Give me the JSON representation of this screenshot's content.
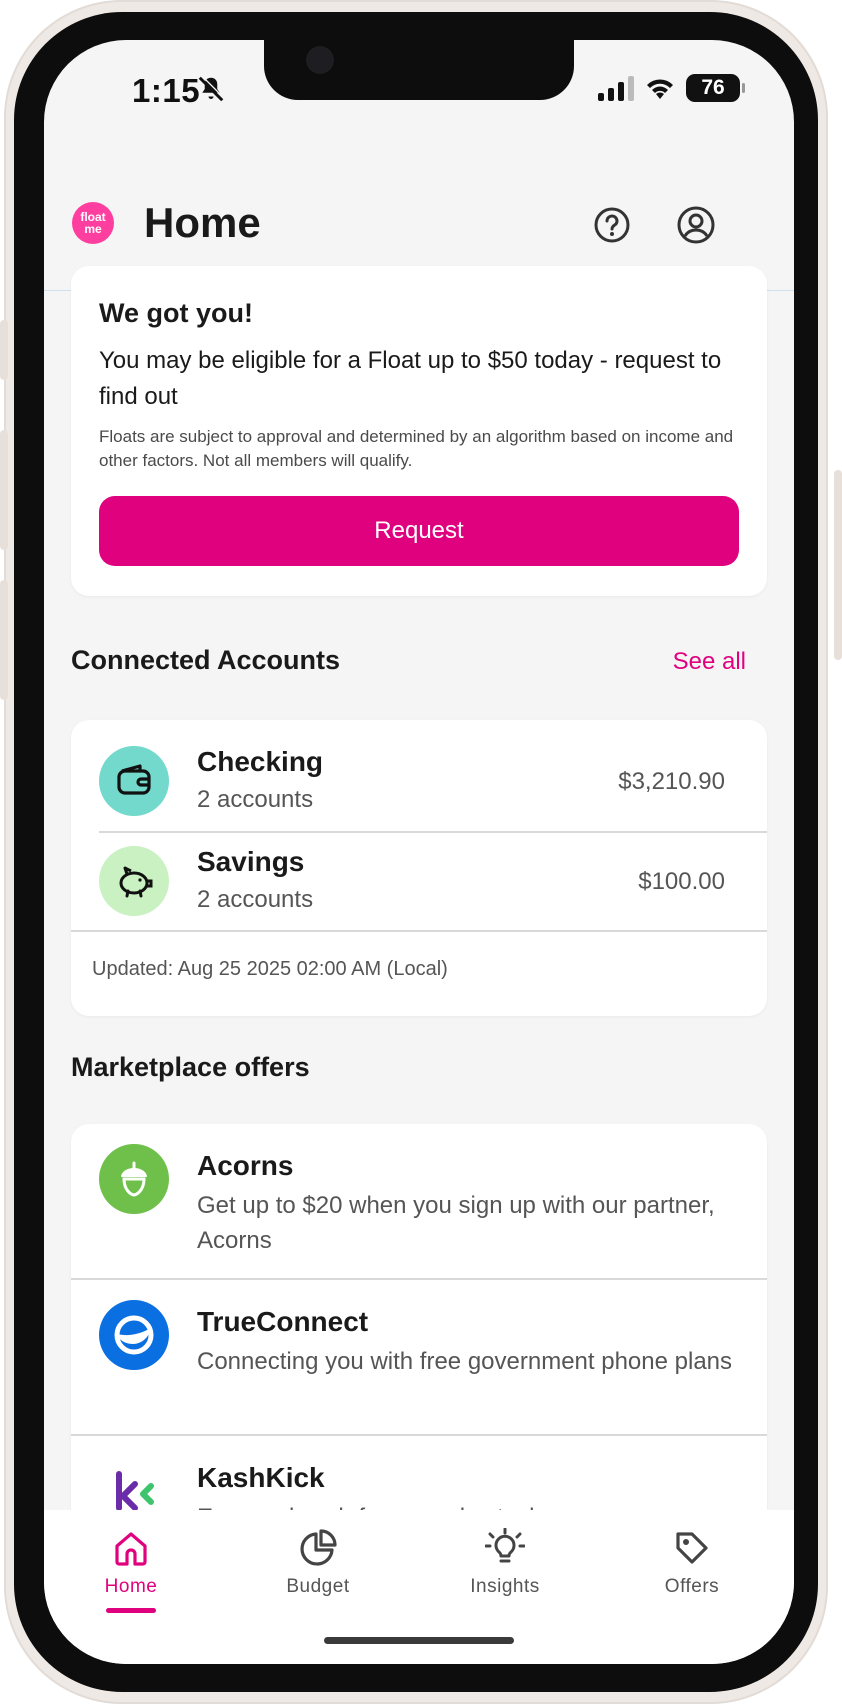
{
  "status": {
    "time": "1:15",
    "battery": "76"
  },
  "header": {
    "title": "Home",
    "logo_text": "float me"
  },
  "promo": {
    "title": "We got you!",
    "body": "You may be eligible for a Float up to $50 today - request to find out",
    "fine_print": "Floats are subject to approval and determined by an algorithm based on income and other factors. Not all members will qualify.",
    "button_label": "Request"
  },
  "accounts": {
    "section_title": "Connected Accounts",
    "see_all_label": "See all",
    "items": [
      {
        "name": "Checking",
        "sub": "2 accounts",
        "amount": "$3,210.90",
        "color": "#72d9cc"
      },
      {
        "name": "Savings",
        "sub": "2 accounts",
        "amount": "$100.00",
        "color": "#c9f1c1"
      }
    ],
    "updated": "Updated: Aug 25 2025 02:00 AM (Local)"
  },
  "offers": {
    "section_title": "Marketplace offers",
    "items": [
      {
        "name": "Acorns",
        "desc": "Get up to $20 when you sign up with our partner, Acorns",
        "color": "#6fc04a"
      },
      {
        "name": "TrueConnect",
        "desc": "Connecting you with free government phone plans",
        "color": "#0a6fe0"
      },
      {
        "name": "KashKick",
        "desc": "Earn real cash for everyday tasks",
        "color": "#6a2ca8"
      }
    ]
  },
  "nav": {
    "items": [
      {
        "label": "Home"
      },
      {
        "label": "Budget"
      },
      {
        "label": "Insights"
      },
      {
        "label": "Offers"
      }
    ]
  },
  "colors": {
    "accent": "#e0017f",
    "logo": "#ff3fa0"
  }
}
